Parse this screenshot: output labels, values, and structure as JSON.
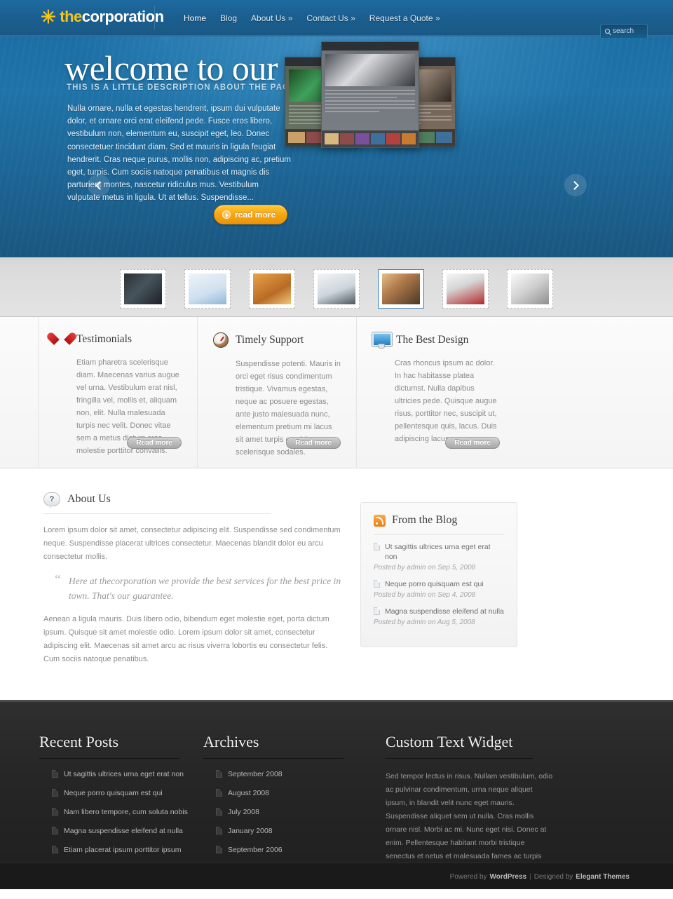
{
  "header": {
    "logo_star": "✳",
    "logo_the": "the",
    "logo_rest": "corporation",
    "nav": [
      {
        "label": "Home",
        "active": true
      },
      {
        "label": "Blog",
        "active": false
      },
      {
        "label": "About Us »",
        "active": false
      },
      {
        "label": "Contact Us »",
        "active": false
      },
      {
        "label": "Request a Quote »",
        "active": false
      }
    ],
    "search_label": "search"
  },
  "hero": {
    "title": "welcome to our site",
    "subtitle": "THIS IS A LITTLE DESCRIPTION ABOUT THE PAGE YOU ARE VIEWING",
    "body": "Nulla ornare, nulla et egestas hendrerit, ipsum dui vulputate dolor, et ornare orci erat eleifend pede. Fusce eros libero, vestibulum non, elementum eu, suscipit eget, leo. Donec consectetuer tincidunt diam. Sed et mauris in ligula feugiat hendrerit. Cras neque purus, mollis non, adipiscing ac, pretium eget, turpis. Cum sociis natoque penatibus et magnis dis parturient montes, nascetur ridiculus mus. Vestibulum vulputate metus in ligula. Ut at tellus. Suspendisse...",
    "read_more": "read more",
    "prev_label": "‹",
    "next_label": "›"
  },
  "thumbstrip": {
    "items": [
      {
        "name": "thumb-1",
        "selected": false
      },
      {
        "name": "thumb-2",
        "selected": false
      },
      {
        "name": "thumb-3",
        "selected": false
      },
      {
        "name": "thumb-4",
        "selected": false
      },
      {
        "name": "thumb-5",
        "selected": true
      },
      {
        "name": "thumb-6",
        "selected": false
      },
      {
        "name": "thumb-7",
        "selected": false
      }
    ]
  },
  "features": {
    "read_more_label": "Read more",
    "items": [
      {
        "icon": "heart-icon",
        "title": "Testimonials",
        "body": "Etiam pharetra scelerisque diam. Maecenas varius augue vel urna. Vestibulum erat nisl, fringilla vel, mollis et, aliquam non, elit. Nulla malesuada turpis nec velit. Donec vitae sem a metus dictum cras molestie porttitor convallis."
      },
      {
        "icon": "clock-icon",
        "title": "Timely Support",
        "body": "Suspendisse potenti. Mauris in orci eget risus condimentum tristique. Vivamus egestas, neque ac posuere egestas, ante justo malesuada nunc, elementum pretium mi lacus sit amet turpis curabitur scelerisque sodales."
      },
      {
        "icon": "monitor-icon",
        "title": "The Best Design",
        "body": "Cras rhoncus ipsum ac dolor. In hac habitasse platea dictumst. Nulla dapibus ultricies pede. Quisque augue risus, porttitor nec, suscipit ut, pellentesque quis, lacus. Duis adipiscing lacus arcu purus."
      }
    ]
  },
  "about": {
    "icon": "help-icon",
    "icon_glyph": "?",
    "title": "About Us",
    "paragraph1": "Lorem ipsum dolor sit amet, consectetur adipiscing elit. Suspendisse sed condimentum neque. Suspendisse placerat ultrices consectetur. Maecenas blandit dolor eu arcu consectetur mollis.",
    "quote_mark": "“",
    "quote": "Here at thecorporation we provide the best services for the best price in town. That's our guarantee.",
    "paragraph2": "Aenean a ligula mauris. Duis libero odio, bibendum eget molestie eget, porta dictum ipsum. Quisque sit amet molestie odio. Lorem ipsum dolor sit amet, consectetur adipiscing elit. Maecenas sit amet arcu ac risus viverra lobortis eu consectetur felis. Cum sociis natoque penatibus."
  },
  "blog_widget": {
    "icon": "rss-icon",
    "title": "From the Blog",
    "items": [
      {
        "title": "Ut sagittis ultrices urna eget erat non",
        "meta": "Posted by admin on Sep 5, 2008"
      },
      {
        "title": "Neque porro quisquam est qui",
        "meta": "Posted by admin on Sep 4, 2008"
      },
      {
        "title": "Magna suspendisse eleifend at nulla",
        "meta": "Posted by admin on Aug 5, 2008"
      }
    ]
  },
  "footer": {
    "recent_posts": {
      "title": "Recent Posts",
      "items": [
        "Ut sagittis ultrices urna eget erat non",
        "Neque porro quisquam est qui",
        "Nam libero tempore, cum soluta nobis",
        "Magna suspendisse eleifend at nulla",
        "Etiam placerat ipsum porttitor ipsum"
      ]
    },
    "archives": {
      "title": "Archives",
      "items": [
        "September 2008",
        "August 2008",
        "July 2008",
        "January 2008",
        "September 2006"
      ]
    },
    "custom_text": {
      "title": "Custom Text Widget",
      "body": "Sed tempor lectus in risus. Nullam vestibulum, odio ac pulvinar condimentum, urna neque aliquet ipsum, in blandit velit nunc eget mauris. Suspendisse aliquet sem ut nulla. Cras mollis ornare nisl. Morbi ac mi. Nunc eget nisi. Donec at enim. Pellentesque habitant morbi tristique senectus et netus et malesuada fames ac turpis egestas."
    },
    "credit": {
      "powered_by": "Powered by",
      "wordpress": "WordPress",
      "pipe": "|",
      "designed_by": "Designed by",
      "elegant_themes": "Elegant Themes"
    }
  },
  "colors": {
    "header_blue": "#1b5f90",
    "hero_blue": "#1f73a8",
    "accent_orange": "#f8a513",
    "logo_yellow": "#f5c518",
    "footer_dark": "#262626",
    "rss_orange": "#ec7e13"
  }
}
